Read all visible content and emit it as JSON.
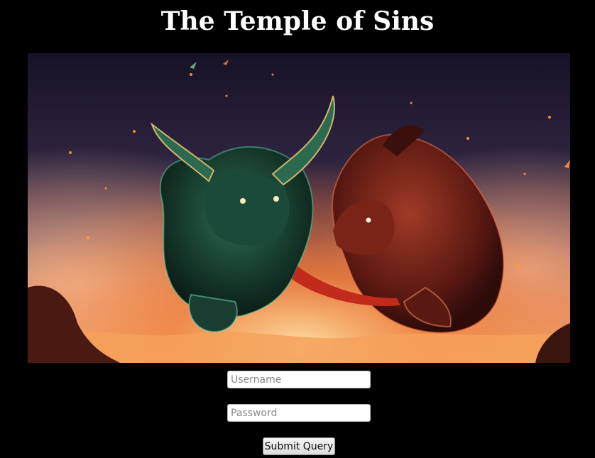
{
  "page": {
    "title": "The Temple of Sins"
  },
  "hero": {
    "image_description": "green bull warrior and red horned beast clashing amid fire and smoke"
  },
  "login_form": {
    "username_placeholder": "Username",
    "username_value": "",
    "password_placeholder": "Password",
    "password_value": "",
    "submit_label": "Submit Query"
  },
  "colors": {
    "background": "#000000",
    "title": "#ffffff",
    "fire": "#f07a2c",
    "green_beast": "#1f4a3a",
    "red_beast": "#6a1e18"
  }
}
